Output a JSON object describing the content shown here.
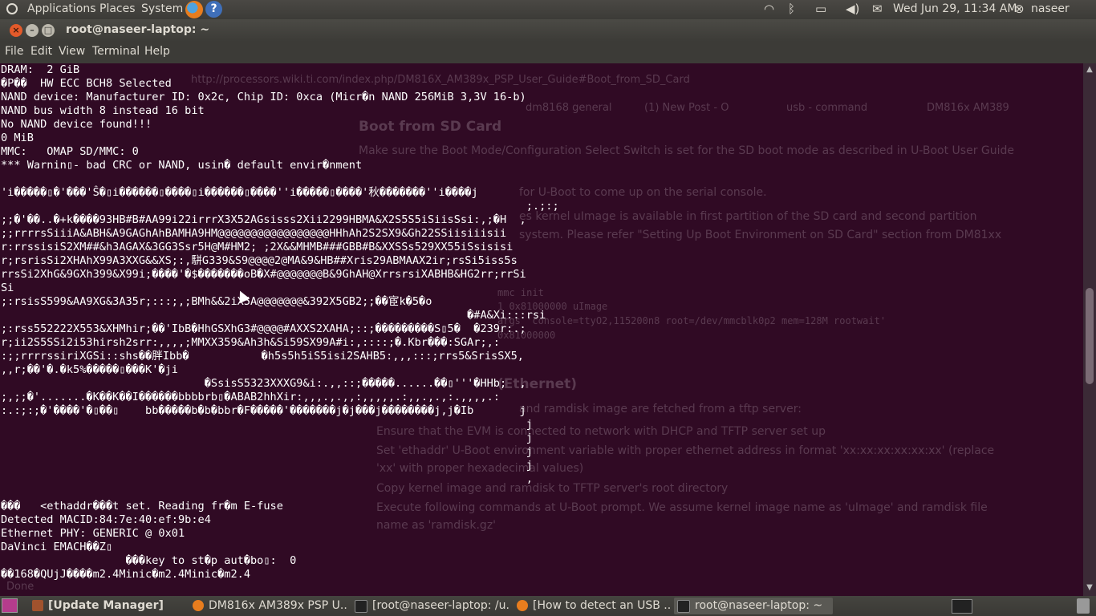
{
  "top_panel": {
    "menus": [
      "Applications",
      "Places",
      "System"
    ],
    "clock": "Wed Jun 29, 11:34 AM",
    "user": "naseer",
    "icons": [
      "ubuntu-logo-icon",
      "firefox-icon",
      "help-icon",
      "wifi-icon",
      "bluetooth-icon",
      "battery-icon",
      "volume-icon",
      "mail-icon",
      "power-icon"
    ]
  },
  "window": {
    "title": "root@naseer-laptop: ~",
    "menus": [
      "File",
      "Edit",
      "View",
      "Terminal",
      "Help"
    ]
  },
  "terminal": {
    "lines": [
      "DRAM:  2 GiB",
      "�P��  HW ECC BCH8 Selected",
      "NAND device: Manufacturer ID: 0x2c, Chip ID: 0xca (Micr�n NAND 256MiB 3,3V 16-b)",
      "NAND bus width 8 instead 16 bit",
      "No NAND device found!!!",
      "0 MiB",
      "MMC:   OMAP SD/MMC: 0",
      "*** Warnin▯- bad CRC or NAND, usin� default envir�nment",
      "",
      "'i�����▯�'���'Ŝ�▯i������▯����▯i������▯����''i�����▯����'秋�������''i����j",
      "                                                                                ;.;:;",
      ";;�'��..�+k����93HB#B#AA99i22irrrX3X52AGsisss2Xii2299HBMA&X2S5S5iSiisSsi:,;�H  ,",
      ";;rrrrsSiiiA&ABH&A9GAGhAhBAMHA9HM@@@@@@@@@@@@@@@@@HHhAh2S2SX9&Gh22SSiisiiisii",
      "r:rrssisiS2XM##&h3AGAX&3GG3Ssr5H@M#HM2; ;2X&&MHMB###GBB#B&XXSSs529XX55iSsisisi",
      "r;rsrisSi2XHAhX99A3XXG&&XS;:,駢G339&S9@@@@2@MA&9&HB##Xris29ABMAAX2ir;rsSi5iss5s",
      "rrsSi2XhG&9GXh399&X99i;����'�$�������oB�X#@@@@@@@B&9GhAH@XrrsrsiXABHB&HG2rr;rrSi",
      "Si",
      ";:rsisS599&AA9XG&3A35r;:::;,;BMh&&2iX5A@@@@@@@&392X5GB2;;��宦k�5�o",
      "                                                                       �#A&Xi:::rsi",
      ";:rss552222X553&XHMhir;��'IbB�HhGSXhG3#@@@@#AXXS2XAHA;::;���������S▯5�  �239r:.;",
      "r;ii2S5SSi2i53hirsh2srr:,,,,;MMXX359&Ah3h&Si59SX99A#i:,::::;�.Kbr���:SGAr;,:",
      ":;;rrrrssiriXGSi::shs��胖Ibb�           �h5s5h5iS5isi2SAHB5:,,,:::;rrs5&SrisSX5,",
      ",,r;��'�.�k5%�����▯���K'�ji",
      "                               �SsisS5323XXXG9&i:.,,::;�����......��▯'''�HHb;  ,",
      ";,;;�'.......�K��K��I������bbbbrb▯�ABAB2hhXir:,,,.,.,,:,,,,,.:,,.,.,:.,,,,.:",
      ":.:;:;�'����'�▯��▯    bb�����b�b�bbr�F�����'�������j�j���j��������j,j�Ib       j",
      "                                                                                j",
      "                                                                                j",
      "                                                                                j",
      "                                                                                j",
      "                                                                                ,",
      "",
      "���   <ethaddr���t set. Reading fr�m E-fuse",
      "Detected MACID:84:7e:40:ef:9b:e4",
      "Ethernet PHY: GENERIC @ 0x01",
      "DaVinci EMACH��Z▯",
      "                   ���key to st�p aut�bo▯:  0",
      "��168�QUjJ����m2.4Minic�m2.4Minic�m2.4"
    ]
  },
  "background_page": {
    "url": "http://processors.wiki.ti.com/index.php/DM816X_AM389x_PSP_User_Guide#Boot_from_SD_Card",
    "tabs": [
      "dm8168 general",
      "(1) New Post - O",
      "usb - command",
      "DM816x AM389"
    ],
    "heading": "Boot from SD Card",
    "para1": "Make sure the Boot Mode/Configuration Select Switch is set for the SD boot mode as described in U-Boot User Guide",
    "step": "for U-Boot to come up on the serial console.",
    "para2a": "es kernel uImage is available in first partition of the SD card and second partition",
    "para2b": "system. Please refer \"Setting Up Boot Environment on SD Card\" section from DM81xx",
    "code1": "mmc init",
    "code2": "1 0x81000000 uImage",
    "code3": "args 'console=ttyO2,115200n8 root=/dev/mmcblk0p2 mem=128M rootwait'",
    "code4": "0x81000000",
    "heading2": "(Ethernet)",
    "para3": "and ramdisk image are fetched from a tftp server:",
    "bullet1": "Ensure that the EVM is connected to network with DHCP and TFTP server set up",
    "bullet2": "Set 'ethaddr' U-Boot environment variable with proper ethernet address in format 'xx:xx:xx:xx:xx:xx' (replace",
    "bullet2b": "'xx' with proper hexadecimal values)",
    "bullet3": "Copy kernel image and ramdisk to TFTP server's root directory",
    "bullet4": "Execute following commands at U-Boot prompt. We assume kernel image name as 'uImage' and ramdisk file",
    "bullet4b": "name as 'ramdisk.gz'",
    "status": "Done"
  },
  "taskbar": {
    "tasks": [
      {
        "label": "[Update Manager]",
        "icon": "update-manager-icon"
      },
      {
        "label": "DM816x AM389x PSP U...",
        "icon": "firefox-icon"
      },
      {
        "label": "[root@naseer-laptop: /u...",
        "icon": "terminal-icon"
      },
      {
        "label": "[How to detect an USB ...",
        "icon": "firefox-icon"
      },
      {
        "label": "root@naseer-laptop: ~",
        "icon": "terminal-icon"
      }
    ]
  },
  "colors": {
    "terminal_bg": "#300a24",
    "panel_bg": "#3c3b37",
    "close_button": "#e45a2a"
  }
}
